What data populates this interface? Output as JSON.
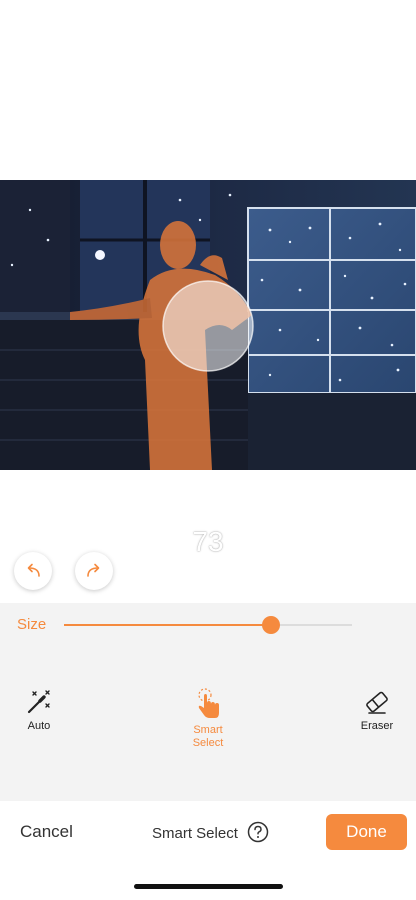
{
  "size_display": "73",
  "history": {
    "undo_icon": "undo-arrow-icon",
    "redo_icon": "redo-arrow-icon"
  },
  "size_control": {
    "label": "Size",
    "value_fraction": 0.72
  },
  "tools": [
    {
      "label": "Auto",
      "icon": "magic-wand-icon",
      "active": false
    },
    {
      "label_line1": "Smart",
      "label_line2": "Select",
      "icon": "hand-pointer-icon",
      "active": true
    },
    {
      "label": "Eraser",
      "icon": "eraser-icon",
      "active": false
    }
  ],
  "bottom_bar": {
    "cancel_label": "Cancel",
    "mode_label": "Smart Select",
    "help_icon": "question-circle-icon",
    "done_label": "Done"
  },
  "colors": {
    "accent": "#f58a3e",
    "panel_bg": "#f3f3f3",
    "text": "#333333"
  }
}
